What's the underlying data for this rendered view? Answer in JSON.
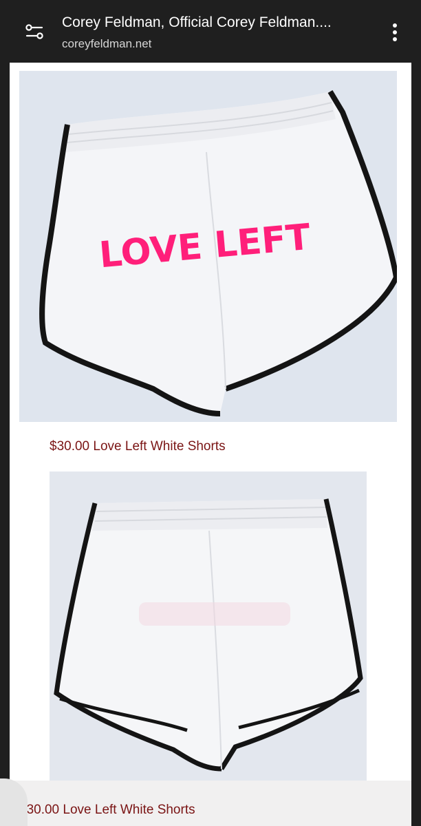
{
  "browser": {
    "title": "Corey Feldman, Official Corey Feldman....",
    "domain": "coreyfeldman.net",
    "site_settings_icon": "tune-icon",
    "menu_icon": "more-vert-icon"
  },
  "products": [
    {
      "price_label": "$30.00 Love Left White Shorts",
      "image_text": "LOVE LEFT",
      "image_description_colors": {
        "fabric": "#f4f5f8",
        "trim": "#141414",
        "print": "#ff1f7a",
        "background": "#dfe5ee"
      }
    },
    {
      "price_label": "$30.00 Love Left White Shorts"
    }
  ]
}
